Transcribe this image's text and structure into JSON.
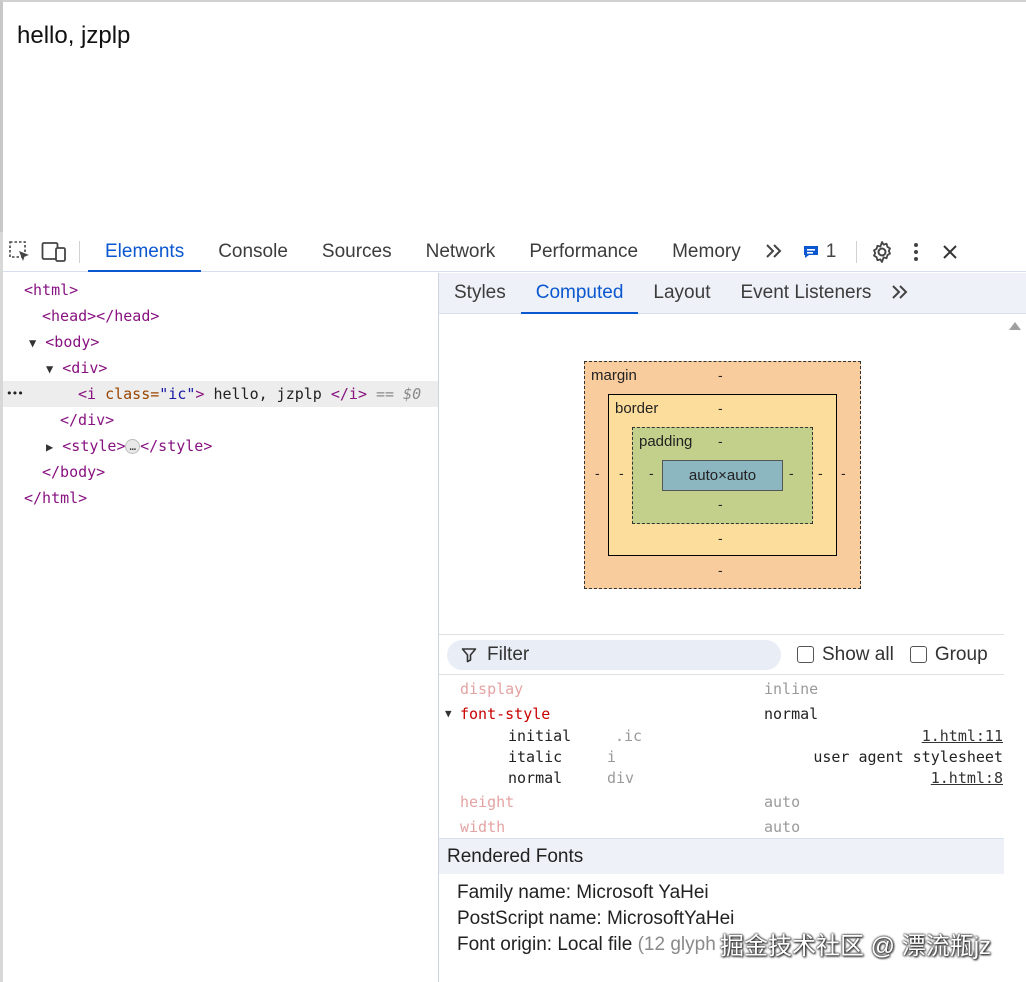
{
  "page": {
    "text": "hello, jzplp"
  },
  "toolbar": {
    "tabs": [
      "Elements",
      "Console",
      "Sources",
      "Network",
      "Performance",
      "Memory"
    ],
    "more": "»",
    "issues_count": "1",
    "icons": [
      "inspect-icon",
      "device-toolbar-icon",
      "chevron-double-icon",
      "issues-icon",
      "gear-icon",
      "kebab-icon",
      "close-icon"
    ]
  },
  "elements": {
    "html_open": "<html>",
    "head": "<head></head>",
    "body_open": "<body>",
    "div_open": "<div>",
    "i_open_tag": "<i",
    "i_attr_name": " class=",
    "i_attr_value": "\"ic\"",
    "i_close_bracket": ">",
    "i_text": " hello, jzplp ",
    "i_close_tag": "</i>",
    "i_marker": " == $0",
    "div_close": "</div>",
    "style_open": "<style>",
    "style_ellipsis": "…",
    "style_close": "</style>",
    "body_close": "</body>",
    "html_close": "</html>",
    "row_dots": "•••"
  },
  "side_tabs": [
    "Styles",
    "Computed",
    "Layout",
    "Event Listeners"
  ],
  "box_model": {
    "margin_label": "margin",
    "border_label": "border",
    "padding_label": "padding",
    "content": "auto×auto",
    "dash": "-"
  },
  "filter": {
    "placeholder": "Filter",
    "show_all": "Show all",
    "group": "Group"
  },
  "computed": {
    "display": {
      "name": "display",
      "value": "inline"
    },
    "font_style": {
      "name": "font-style",
      "value": "normal",
      "traces": [
        {
          "value": "initial",
          "selector": ".ic",
          "source": "1.html:11"
        },
        {
          "value": "italic",
          "selector": "i",
          "source": "user agent stylesheet"
        },
        {
          "value": "normal",
          "selector": "div",
          "source": "1.html:8"
        }
      ]
    },
    "height": {
      "name": "height",
      "value": "auto"
    },
    "width": {
      "name": "width",
      "value": "auto"
    }
  },
  "rendered_fonts": {
    "header": "Rendered Fonts",
    "family": "Family name: Microsoft YaHei",
    "postscript": "PostScript name: MicrosoftYaHei",
    "origin_label": "Font origin: Local file",
    "origin_detail": "(12 glyph"
  },
  "watermark": "掘金技术社区 @ 漂流瓶jz",
  "colors": {
    "accent": "#0b57d0",
    "margin": "#f9cc9d",
    "border": "#fddd9b",
    "padding": "#c3d08b",
    "content": "#8cb6c0"
  }
}
